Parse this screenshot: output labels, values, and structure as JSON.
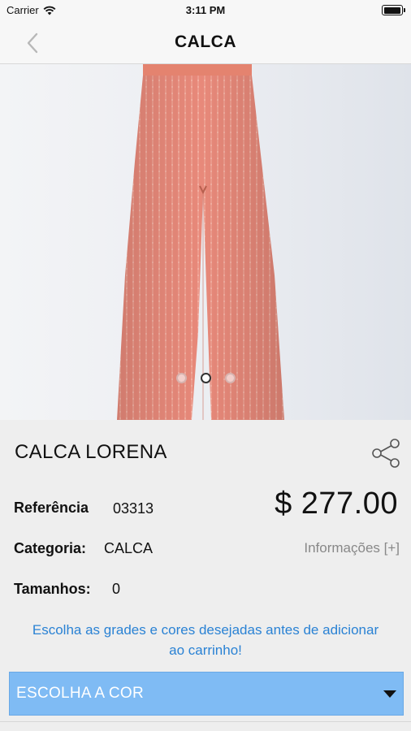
{
  "status_bar": {
    "carrier": "Carrier",
    "time": "3:11 PM",
    "battery_level": 0.9
  },
  "nav": {
    "title": "CALCA",
    "back_icon": "chevron-left-icon"
  },
  "gallery": {
    "image_description_icon": "product-photo",
    "page_count": 3,
    "current_page": 2,
    "garment_color": "#e8897a"
  },
  "product": {
    "name": "CALCA LORENA",
    "price": "$ 277.00",
    "reference_label": "Referência",
    "reference_value": "03313",
    "category_label": "Categoria:",
    "category_value": "CALCA",
    "sizes_label": "Tamanhos:",
    "sizes_value": "0",
    "info_link": "Informações [+]"
  },
  "notice": "Escolha as grades e cores desejadas antes de adicionar ao carrinho!",
  "color_select": {
    "label": "ESCOLHA A COR",
    "accent": "#7fbbf4"
  }
}
